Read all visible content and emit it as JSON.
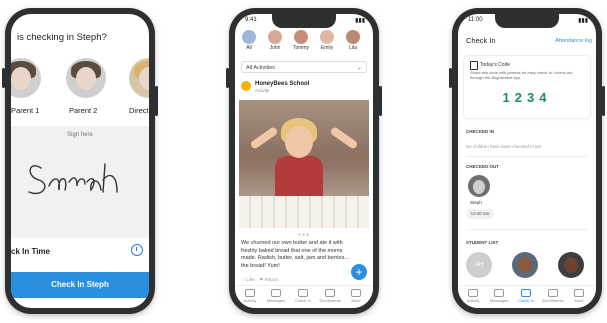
{
  "phone1": {
    "question": "is checking in Steph?",
    "people": [
      {
        "label": "Parent 1"
      },
      {
        "label": "Parent 2"
      },
      {
        "label": "Directo"
      }
    ],
    "sign_label": "Sign here",
    "signature_text": "Sarah",
    "checkin_time_label": "ck In Time",
    "cta_label": "Check In Steph"
  },
  "phone2": {
    "time": "9:41",
    "kids": [
      {
        "name": "All"
      },
      {
        "name": "John"
      },
      {
        "name": "Tommy"
      },
      {
        "name": "Emily"
      },
      {
        "name": "Lila"
      }
    ],
    "filter": "All Activities",
    "school": {
      "name": "HoneyBees School",
      "sub": "Activity"
    },
    "post_text": "We churned our own butter and ate it with freshly baked bread that one of the moms made. Radish, butter, salt, jam and berries... the bread! Yum!",
    "likes": "♡ Like   ⚑ Report",
    "fab": "+",
    "tabs": [
      "Activity",
      "Messages",
      "Check In",
      "Enrollments",
      "More"
    ]
  },
  "phone3": {
    "time": "11:00",
    "title": "Check In",
    "attendance_link": "Attendance log",
    "code_title": "Today's Code",
    "code_desc": "Share this code with parents for easy check-in / check-out through the Brightwheel app.",
    "code": "1234",
    "checked_in_label": "CHECKED IN",
    "checked_in_empty": "No children have been checked in yet",
    "checked_out_label": "CHECKED OUT",
    "checked_out_name": "Steph",
    "checked_out_time": "10:40 am",
    "student_list_label": "STUDENT LIST",
    "roster_initials": "AH",
    "tabs": [
      "Activity",
      "Messages",
      "Check In",
      "Enrollments",
      "More"
    ]
  }
}
